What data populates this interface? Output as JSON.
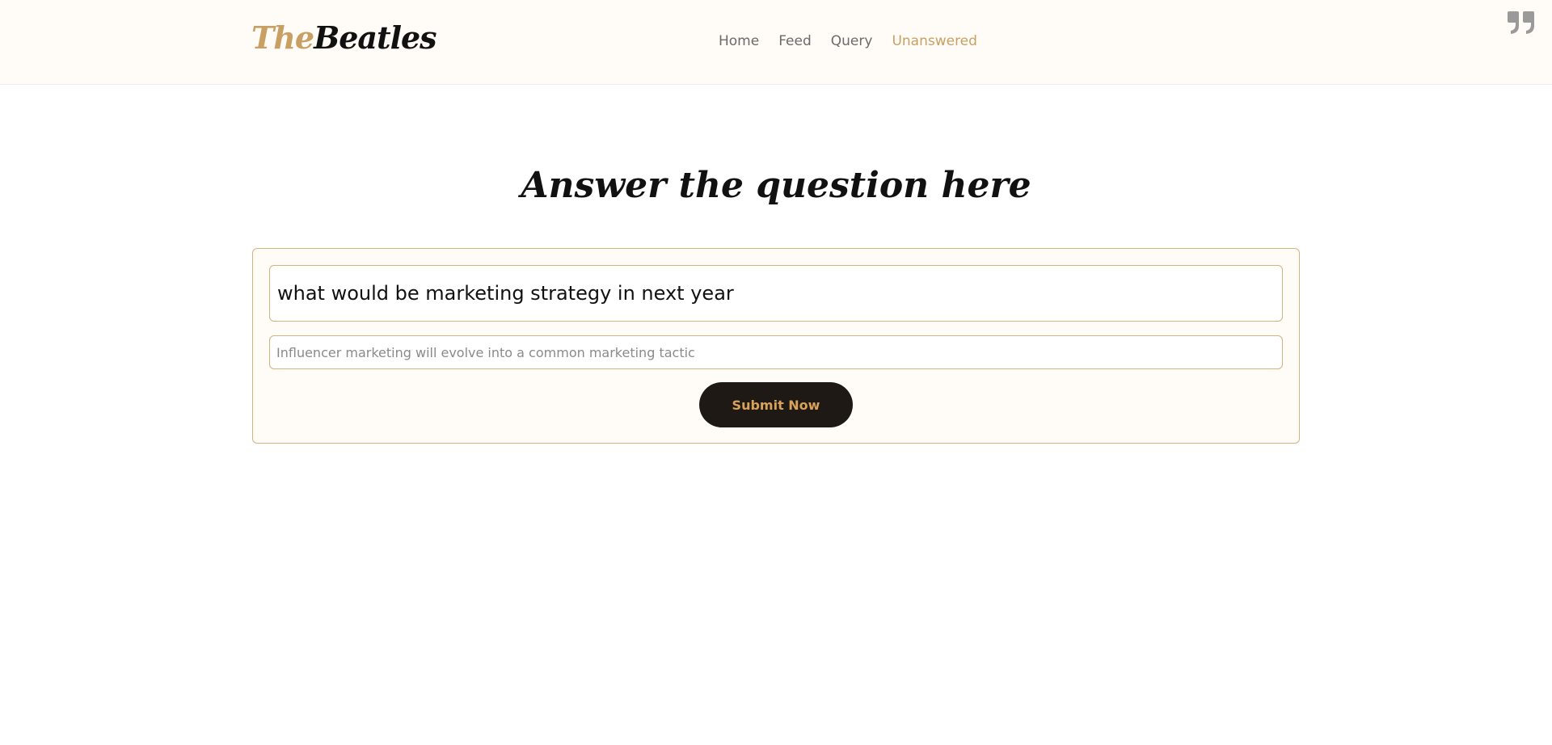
{
  "header": {
    "logo": {
      "part1": "The",
      "part2": "Beatles"
    },
    "nav": [
      {
        "label": "Home",
        "active": false
      },
      {
        "label": "Feed",
        "active": false
      },
      {
        "label": "Query",
        "active": false
      },
      {
        "label": "Unanswered",
        "active": true
      }
    ],
    "quote_icon": "quote-icon"
  },
  "main": {
    "title": "Answer the question here",
    "question": "what would be marketing strategy in next year",
    "answer": {
      "value": "",
      "placeholder": "Influencer marketing will evolve into a common marketing tactic"
    },
    "submit_label": "Submit Now"
  },
  "colors": {
    "accent": "#c9a063",
    "header_bg": "#fffbf6",
    "card_border": "#d6b27e",
    "button_bg": "#1e1914",
    "button_text": "#d9a25a",
    "nav_text": "#6b6b6b"
  }
}
